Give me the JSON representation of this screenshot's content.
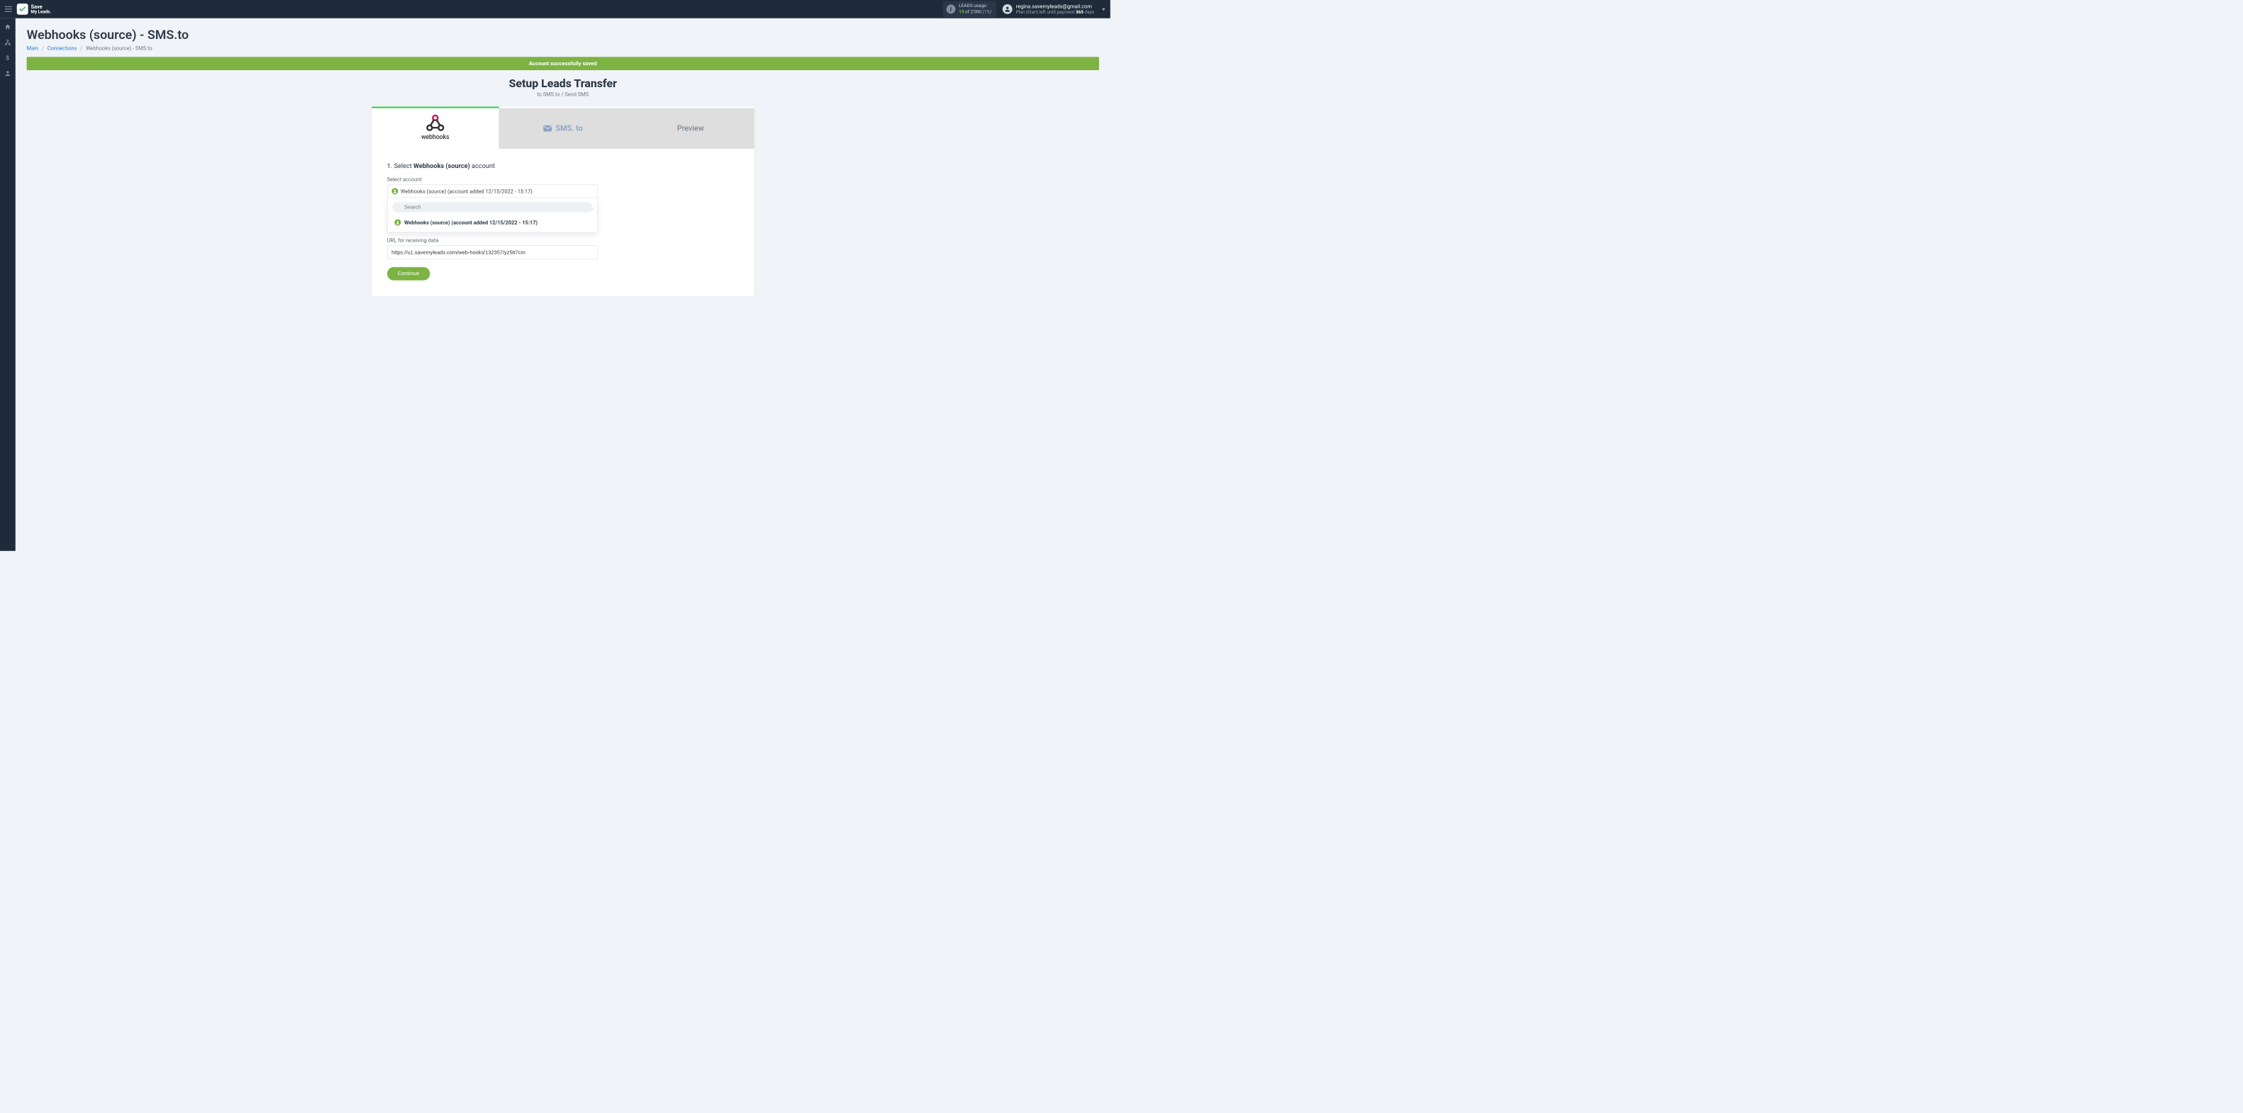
{
  "brand": {
    "line1": "Save",
    "line2": "My Leads."
  },
  "header": {
    "leads_usage": {
      "label": "LEADS usage:",
      "count": "13",
      "of_word": "of",
      "total": "2'000",
      "pct": "(1%)"
    },
    "user": {
      "email": "regina.savemyleads@gmail.com",
      "plan_prefix": "Plan |Start| left until payment ",
      "days": "365",
      "days_suffix": " days"
    }
  },
  "page": {
    "title": "Webhooks (source) - SMS.to",
    "breadcrumbs": {
      "main": "Main",
      "connections": "Connections",
      "current": "Webhooks (source) - SMS.to"
    },
    "alert": "Account successfully saved",
    "setup_heading": "Setup Leads Transfer",
    "setup_sub": "to SMS.to / Send SMS"
  },
  "tabs": {
    "webhooks_label": "webhooks",
    "smsto_label": "SMS. to",
    "preview_label": "Preview"
  },
  "step1": {
    "number": "1. ",
    "text_prefix": "Select ",
    "text_bold": "Webhooks (source)",
    "text_suffix": " account",
    "select_label": "Select account",
    "selected_value": "Webhooks (source) (account added 12/15/2022 - 15:17)",
    "search_placeholder": "Search",
    "option_value": "Webhooks (source) (account added 12/15/2022 - 15:17)",
    "url_label": "URL for receiving data",
    "url_value": "https://u1.savemyleads.com/web-hooks/132357/yz5tt7cm",
    "continue_label": "Continue"
  },
  "colors": {
    "accent_green": "#7cb342",
    "brand_dark": "#1f2b3a",
    "link": "#1f7ad6"
  }
}
